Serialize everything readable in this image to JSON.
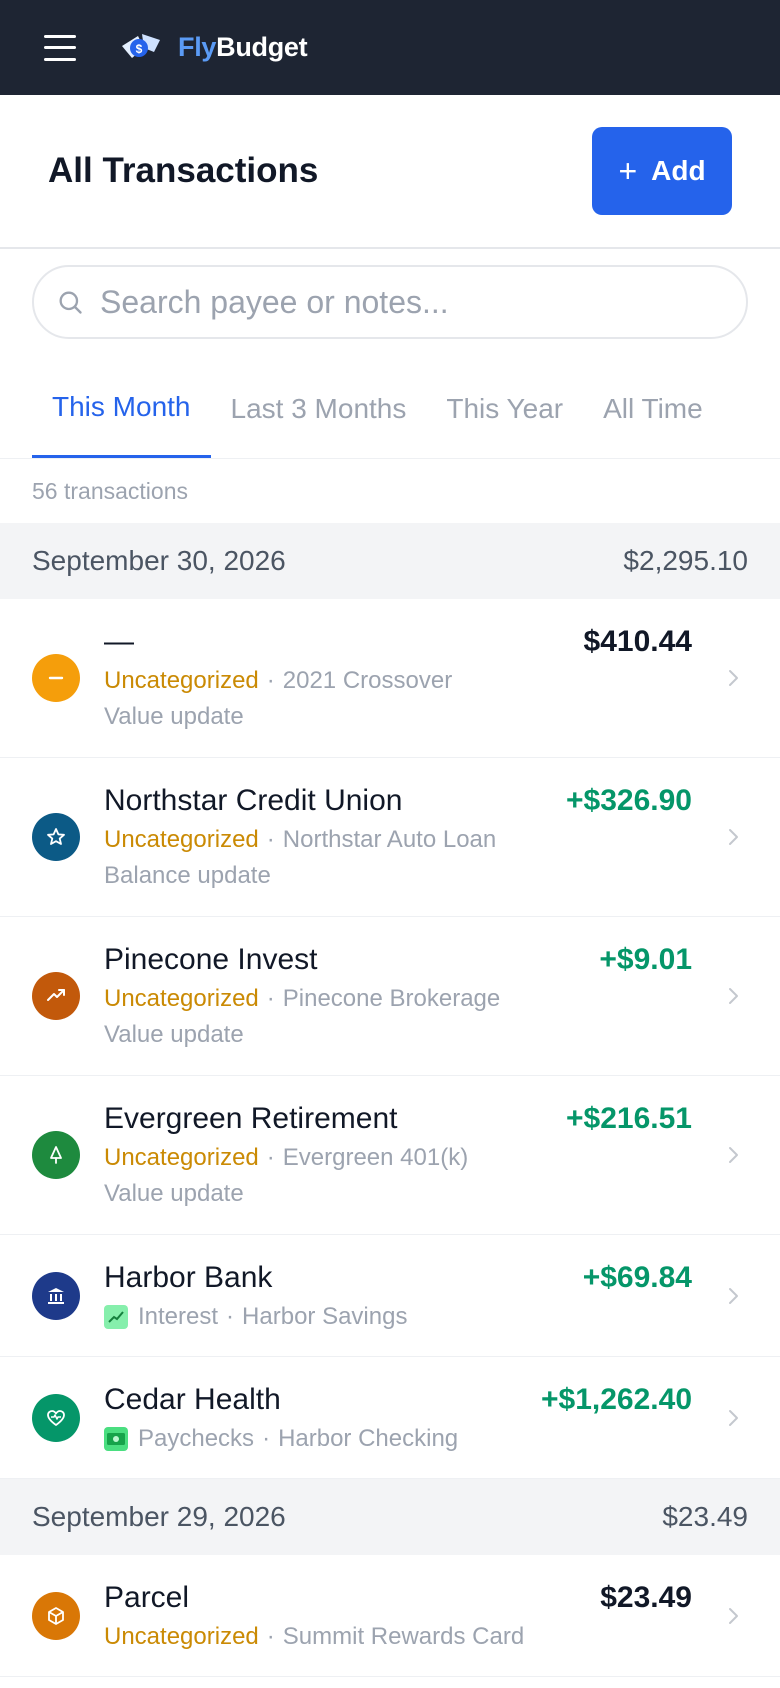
{
  "app": {
    "brand_fly": "Fly",
    "brand_budget": "Budget"
  },
  "header": {
    "title": "All Transactions",
    "add_label": "Add"
  },
  "search": {
    "placeholder": "Search payee or notes..."
  },
  "tabs": [
    {
      "label": "This Month",
      "active": true
    },
    {
      "label": "Last 3 Months",
      "active": false
    },
    {
      "label": "This Year",
      "active": false
    },
    {
      "label": "All Time",
      "active": false
    }
  ],
  "count_label": "56 transactions",
  "groups": [
    {
      "date": "September 30, 2026",
      "total": "$2,295.10",
      "items": [
        {
          "payee": "—",
          "amount": "$410.44",
          "category": "Uncategorized",
          "account": "2021 Crossover",
          "note": "Value update",
          "icon": "minus-icon"
        },
        {
          "payee": "Northstar Credit Union",
          "amount": "+$326.90",
          "category": "Uncategorized",
          "account": "Northstar Auto Loan",
          "note": "Balance update",
          "icon": "star-icon"
        },
        {
          "payee": "Pinecone Invest",
          "amount": "+$9.01",
          "category": "Uncategorized",
          "account": "Pinecone Brokerage",
          "note": "Value update",
          "icon": "trending-up-icon"
        },
        {
          "payee": "Evergreen Retirement",
          "amount": "+$216.51",
          "category": "Uncategorized",
          "account": "Evergreen 401(k)",
          "note": "Value update",
          "icon": "tree-icon"
        },
        {
          "payee": "Harbor Bank",
          "amount": "+$69.84",
          "category": "Interest",
          "account": "Harbor Savings",
          "note": "",
          "icon": "bank-icon"
        },
        {
          "payee": "Cedar Health",
          "amount": "+$1,262.40",
          "category": "Paychecks",
          "account": "Harbor Checking",
          "note": "",
          "icon": "heart-pulse-icon"
        }
      ]
    },
    {
      "date": "September 29, 2026",
      "total": "$23.49",
      "items": [
        {
          "payee": "Parcel",
          "amount": "$23.49",
          "category": "Uncategorized",
          "account": "Summit Rewards Card",
          "note": "",
          "icon": "package-icon"
        }
      ]
    }
  ],
  "colors": {
    "topbar": "#1e2533",
    "accent": "#2563eb",
    "positive": "#059669",
    "uncategorized": "#ca8a04"
  }
}
